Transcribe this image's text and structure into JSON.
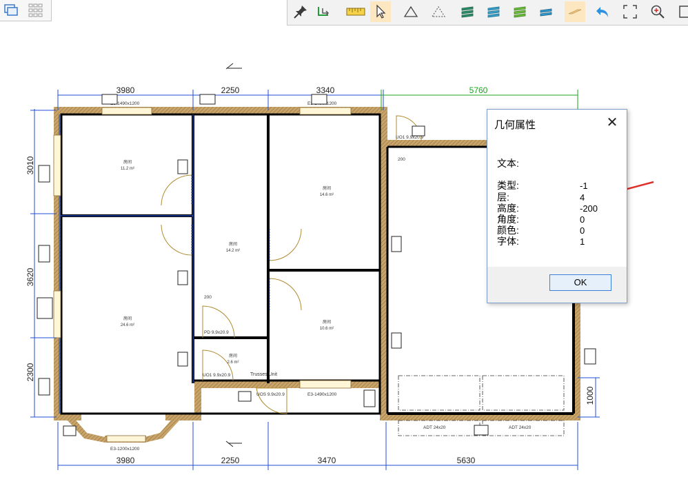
{
  "toolbar_left": {
    "icons": [
      "window-icon",
      "grid-icon"
    ]
  },
  "toolbar_right": {
    "icons": [
      "pin-icon",
      "rotate-arrow-icon",
      "ruler-icon",
      "pointer-icon",
      "triangle-icon",
      "triangle-dashed-icon",
      "layers-1-icon",
      "layers-2-icon",
      "layers-3-icon",
      "layers-4-icon",
      "plane-icon",
      "undo-icon",
      "fit-view-icon",
      "zoom-in-icon",
      "frame-icon"
    ],
    "active": [
      "pointer-icon",
      "plane-icon"
    ]
  },
  "drawing": {
    "dims_top": [
      "3980",
      "2250",
      "3340",
      "5760"
    ],
    "dims_bottom": [
      "3980",
      "2250",
      "3470",
      "5630"
    ],
    "dims_left": [
      "3010",
      "3620",
      "2300"
    ],
    "dim_right": "1000",
    "window_top_1": "E3-1490x1200",
    "window_top_2": "E3-1490x1200",
    "window_bottom_1": "E3-1490x1200",
    "window_bottom_bay": "E3-1200x1200",
    "door_small": "UO1 9.9x20.9",
    "door_garage_1": "ADT 24x20",
    "door_garage_2": "ADT 24x20",
    "label_trusses": "Trusses Unit",
    "label_pd": "PD 9.9x20.9",
    "label_uo1": "UO1 9.9x20.9",
    "label_uos": "UOS 9.9x20.9",
    "label_200_a": "200",
    "label_200_b": "200",
    "rooms": [
      {
        "name": "房间",
        "area": "11.2 m²"
      },
      {
        "name": "房间",
        "area": "14.2 m²"
      },
      {
        "name": "房间",
        "area": "14.6 m²"
      },
      {
        "name": "房间",
        "area": "24.6 m²"
      },
      {
        "name": "房间",
        "area": "10.6 m²"
      },
      {
        "name": "房间",
        "area": "2.6 m²"
      }
    ]
  },
  "dialog": {
    "title": "几何属性",
    "close": "✕",
    "text_label": "文本:",
    "props": [
      {
        "label": "类型:",
        "value": "-1"
      },
      {
        "label": "层:",
        "value": "4"
      },
      {
        "label": "高度:",
        "value": "-200"
      },
      {
        "label": "角度:",
        "value": "0"
      },
      {
        "label": "颜色:",
        "value": "0"
      },
      {
        "label": "字体:",
        "value": "1"
      }
    ],
    "ok": "OK"
  },
  "colors": {
    "wall_fill": "#c8a36a",
    "dim_line": "#1f4fd6",
    "dim_green": "#1aa51a",
    "highlight": "#e0302a"
  }
}
